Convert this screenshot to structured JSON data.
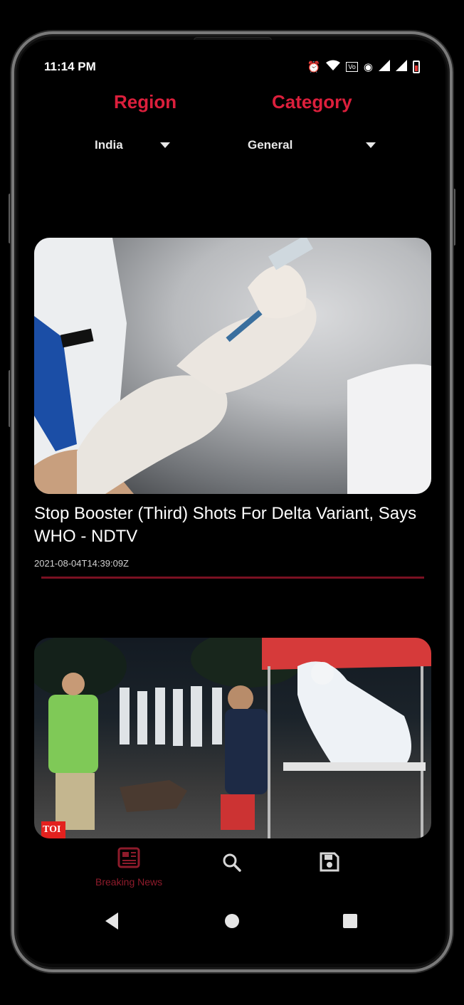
{
  "status_bar": {
    "time": "11:14 PM"
  },
  "filters": {
    "region_label": "Region",
    "category_label": "Category",
    "region_value": "India",
    "category_value": "General"
  },
  "articles": [
    {
      "title": "Stop Booster (Third) Shots For Delta Variant, Says WHO - NDTV",
      "published": "2021-08-04T14:39:09Z"
    },
    {
      "badge": "TOI"
    }
  ],
  "bottom_nav": {
    "items": [
      {
        "label": "Breaking News",
        "icon": "newspaper-icon",
        "active": true
      },
      {
        "icon": "search-icon"
      },
      {
        "icon": "save-icon"
      }
    ]
  },
  "colors": {
    "accent": "#dc1f3c",
    "background": "#000000"
  }
}
